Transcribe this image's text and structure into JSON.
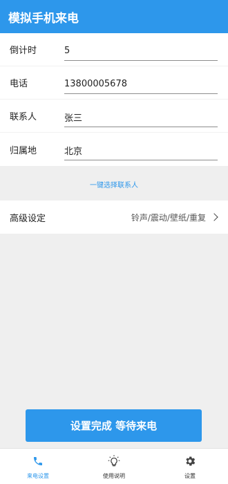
{
  "app_bar": {
    "title": "模拟手机来电"
  },
  "form": {
    "rows": [
      {
        "label": "倒计时",
        "value": "5"
      },
      {
        "label": "电话",
        "value": "13800005678"
      },
      {
        "label": "联系人",
        "value": "张三"
      },
      {
        "label": "归属地",
        "value": "北京"
      }
    ]
  },
  "quick_pick_label": "一键选择联系人",
  "advanced": {
    "label": "高级设定",
    "summary": "铃声/震动/壁纸/重复"
  },
  "cta_label": "设置完成 等待来电",
  "bottom_nav": {
    "items": [
      {
        "label": "来电设置",
        "icon": "phone-icon",
        "active": true
      },
      {
        "label": "使用说明",
        "icon": "lightbulb-icon",
        "active": false
      },
      {
        "label": "设置",
        "icon": "gear-icon",
        "active": false
      }
    ]
  },
  "colors": {
    "accent": "#2d97eb",
    "background": "#efefef"
  }
}
